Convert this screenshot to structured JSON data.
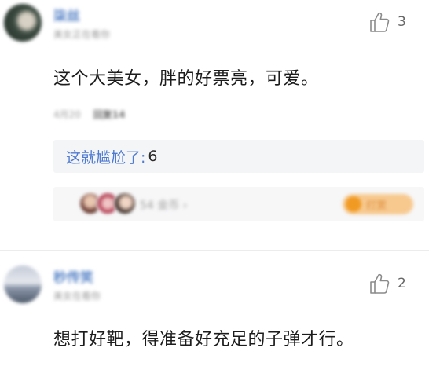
{
  "comments": [
    {
      "username": "柒丝",
      "meta": "美女正在看你",
      "like_count": "3",
      "text": "这个大美女，胖的好票亮，可爱。",
      "stats_prefix": "4月20",
      "stats_bold": "回复14",
      "reply": {
        "author": "这就尴尬了:",
        "text": "6"
      },
      "reward": {
        "count_text": "54 金币 ›",
        "button_label": "打赏"
      }
    },
    {
      "username": "秒传笑",
      "meta": "美女在看你",
      "like_count": "2",
      "text": "想打好靶，得准备好充足的子弹才行。"
    }
  ],
  "icons": {
    "like": "thumbs-up-icon",
    "coin": "coin-icon"
  },
  "colors": {
    "username": "#5b86c8",
    "reply_author": "#4f7ad1",
    "reply_bg": "#f4f5f7",
    "reward_button": "#f7c98f"
  }
}
